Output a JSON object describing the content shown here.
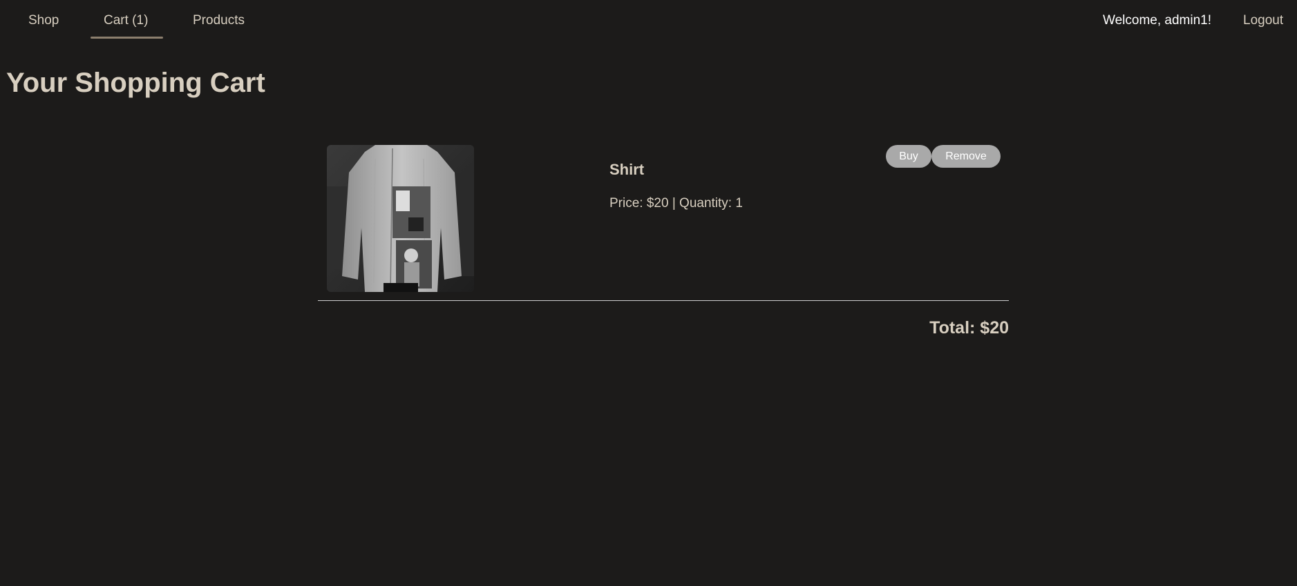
{
  "nav": {
    "shop": "Shop",
    "cart": "Cart (1)",
    "products": "Products",
    "active": "cart"
  },
  "user": {
    "welcome": "Welcome, admin1!",
    "logout": "Logout"
  },
  "page": {
    "title": "Your Shopping Cart"
  },
  "cart": {
    "items": [
      {
        "name": "Shirt",
        "meta": "Price: $20 | Quantity: 1",
        "buy_label": "Buy",
        "remove_label": "Remove"
      }
    ],
    "total": "Total: $20"
  },
  "colors": {
    "background": "#1c1b1a",
    "text": "#d8cfc0",
    "accent_underline": "#8c7f6e",
    "button": "#a9a9a9"
  }
}
